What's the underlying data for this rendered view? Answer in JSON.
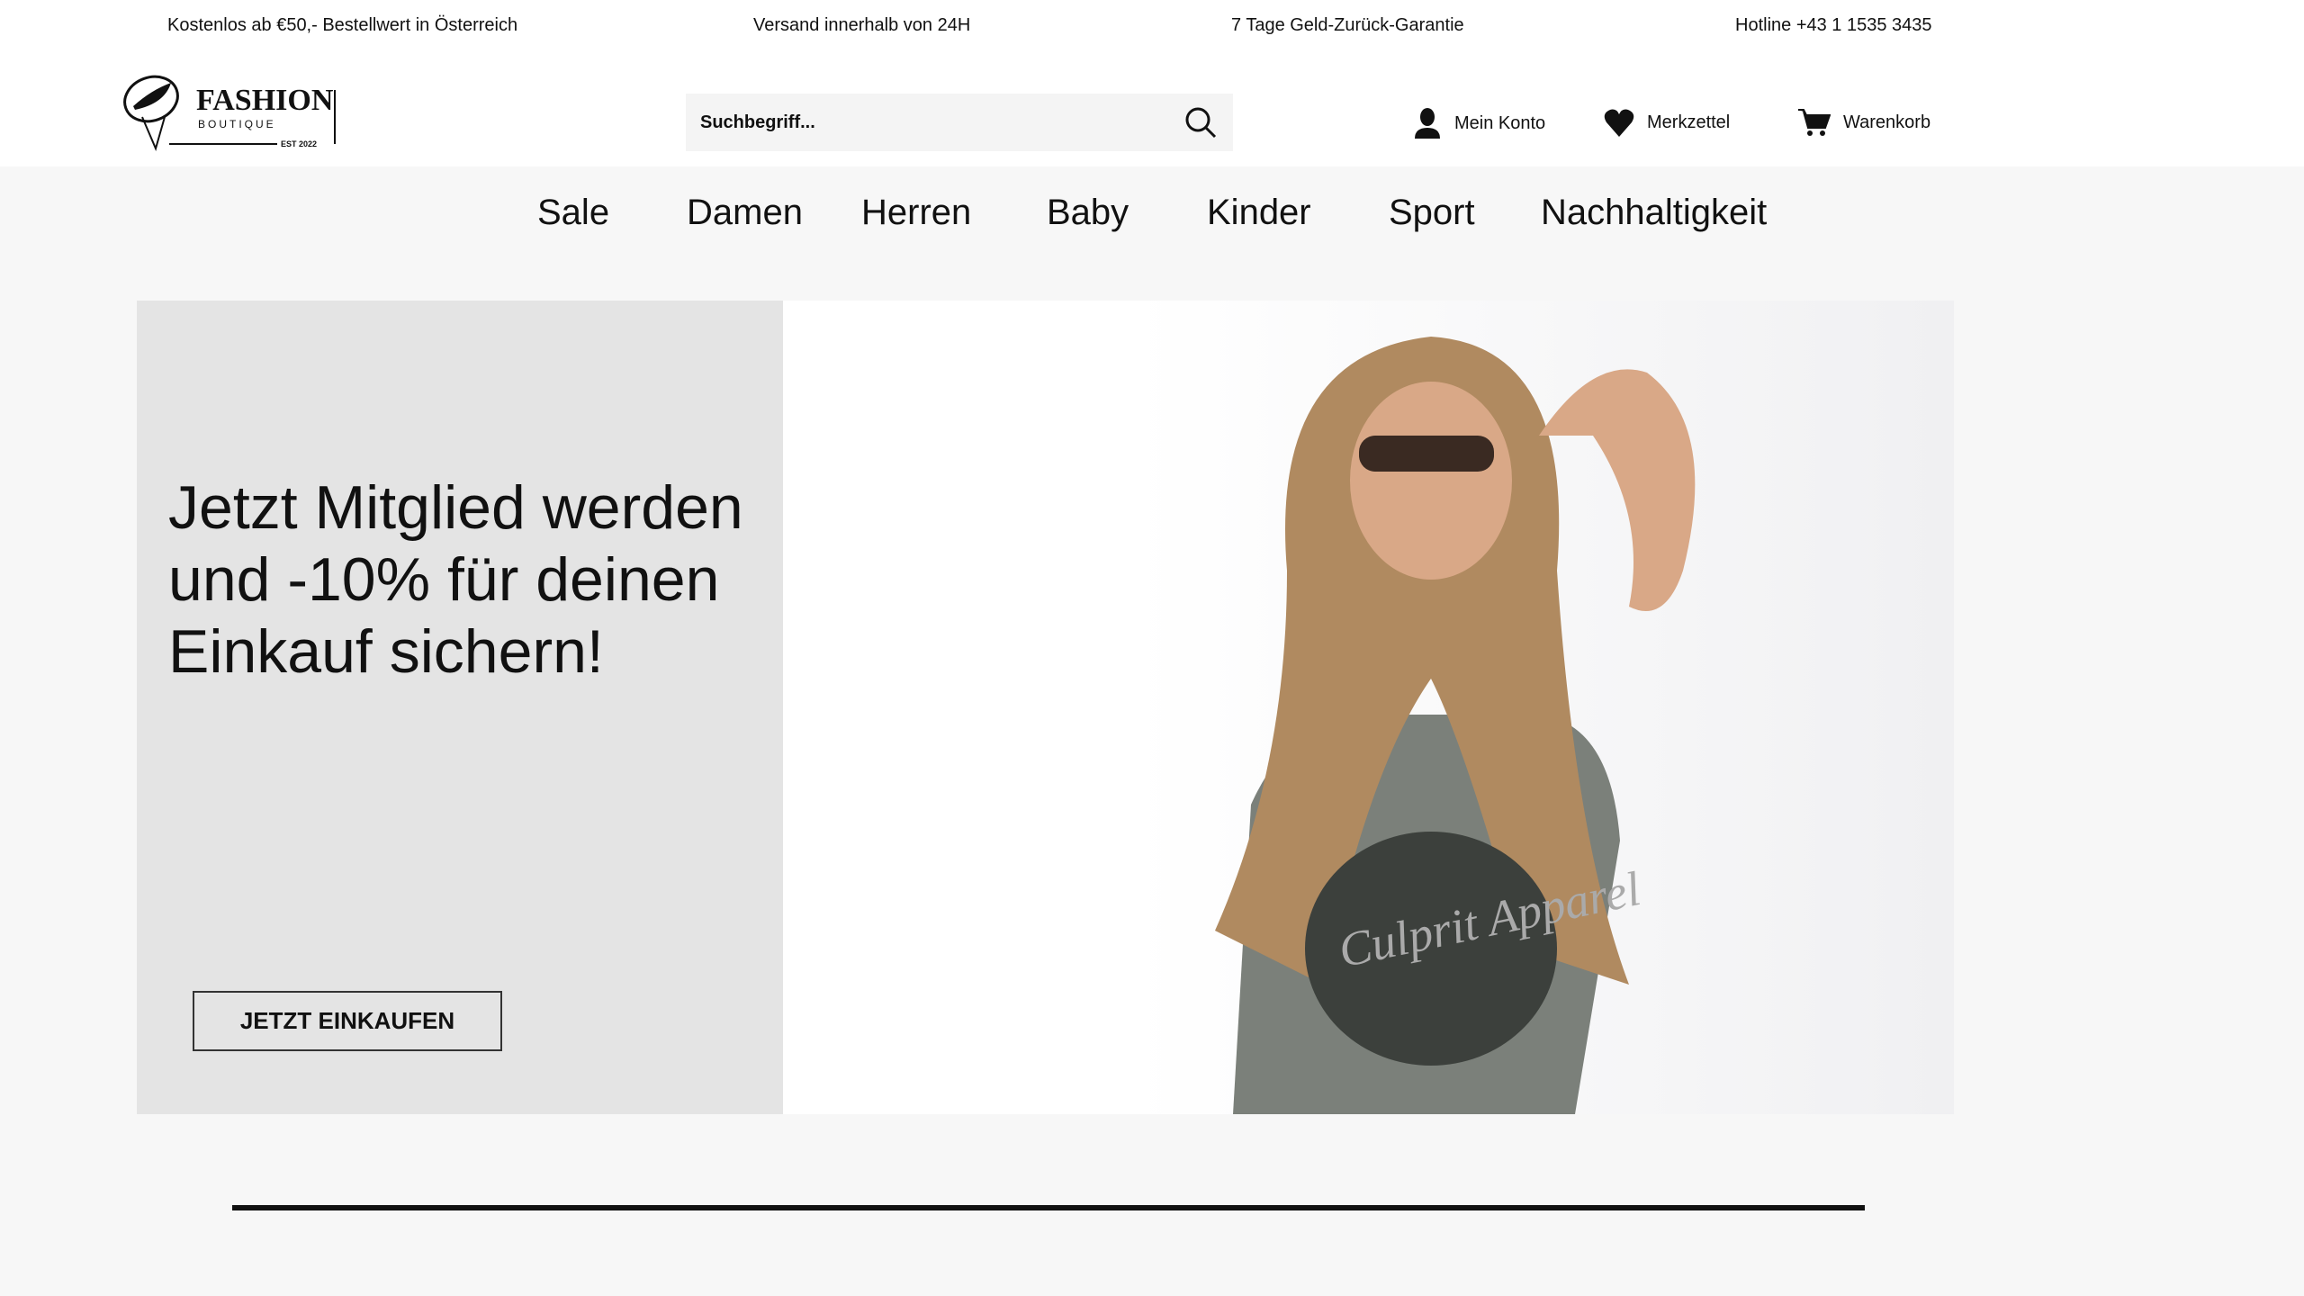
{
  "topbar": [
    "Kostenlos ab €50,- Bestellwert in Österreich",
    "Versand innerhalb von 24H",
    "7 Tage Geld-Zurück-Garantie",
    "Hotline +43 1 1535 3435"
  ],
  "logo": {
    "name": "FASHION",
    "sub": "BOUTIQUE",
    "est": "EST 2022"
  },
  "search": {
    "placeholder": "Suchbegriff...",
    "icon": "search-icon"
  },
  "account": [
    {
      "label": "Mein Konto",
      "icon": "user-icon"
    },
    {
      "label": "Merkzettel",
      "icon": "heart-icon"
    },
    {
      "label": "Warenkorb",
      "icon": "cart-icon"
    }
  ],
  "nav": [
    "Sale",
    "Damen",
    "Herren",
    "Baby",
    "Kinder",
    "Sport",
    "Nachhaltigkeit"
  ],
  "hero": {
    "heading": "Jetzt Mitglied werden und -10% für deinen Einkauf sichern!",
    "button": "JETZT EINKAUFEN",
    "shirt_text": "Culprit Apparel"
  }
}
